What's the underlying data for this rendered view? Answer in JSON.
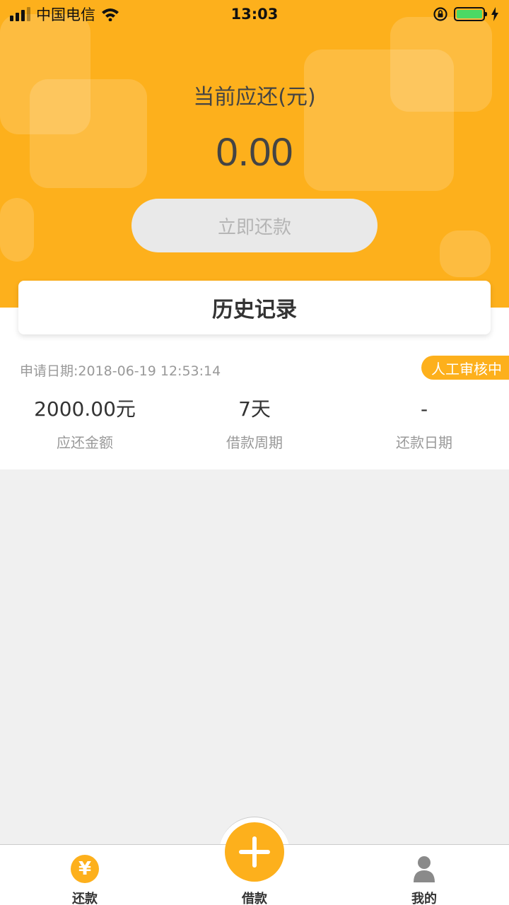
{
  "status_bar": {
    "carrier": "中国电信",
    "time": "13:03"
  },
  "hero": {
    "label": "当前应还(元)",
    "amount": "0.00",
    "pay_button": "立即还款"
  },
  "history": {
    "title": "历史记录"
  },
  "record": {
    "date": "申请日期:2018-06-19 12:53:14",
    "status": "人工审核中",
    "columns": [
      {
        "value": "2000.00元",
        "label": "应还金额"
      },
      {
        "value": "7天",
        "label": "借款周期"
      },
      {
        "value": "-",
        "label": "还款日期"
      }
    ]
  },
  "tabbar": {
    "repay": "还款",
    "borrow": "借款",
    "mine": "我的"
  },
  "colors": {
    "accent": "#fdb01c",
    "badge_text": "#ffffff"
  }
}
